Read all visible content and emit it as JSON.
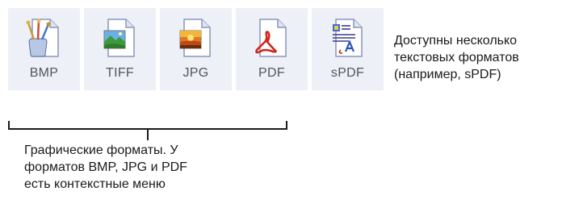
{
  "format_buttons": [
    {
      "label": "BMP",
      "icon": "paint-brushes-document-icon"
    },
    {
      "label": "TIFF",
      "icon": "landscape-image-document-icon"
    },
    {
      "label": "JPG",
      "icon": "sunset-image-document-icon"
    },
    {
      "label": "PDF",
      "icon": "acrobat-pdf-document-icon"
    },
    {
      "label": "sPDF",
      "icon": "searchable-pdf-document-icon"
    }
  ],
  "side_description": [
    "Доступны несколько",
    "текстовых форматов",
    "(например, sPDF)"
  ],
  "bracket_description": [
    "Графические форматы. У",
    "форматов BMP, JPG и PDF",
    "есть контекстные меню"
  ],
  "colors": {
    "button_background": "#eef0f8",
    "button_label": "#555555",
    "text": "#1a1a1a",
    "bracket": "#1a1a1a"
  }
}
